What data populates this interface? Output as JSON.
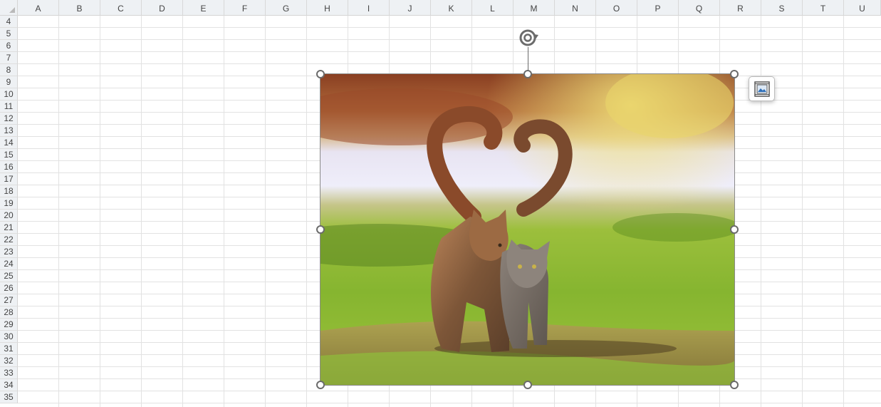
{
  "columns": [
    "A",
    "B",
    "C",
    "D",
    "E",
    "F",
    "G",
    "H",
    "I",
    "J",
    "K",
    "L",
    "M",
    "N",
    "O",
    "P",
    "Q",
    "R",
    "S",
    "T",
    "U"
  ],
  "rows": [
    "4",
    "5",
    "6",
    "7",
    "8",
    "9",
    "10",
    "11",
    "12",
    "13",
    "14",
    "15",
    "16",
    "17",
    "18",
    "19",
    "20",
    "21",
    "22",
    "23",
    "24",
    "25",
    "26",
    "27",
    "28",
    "29",
    "30",
    "31",
    "32",
    "33",
    "34",
    "35"
  ],
  "picture": {
    "subject": "two tabby cats walking on grass with tails forming a heart",
    "selected": true
  },
  "icons": {
    "rotate": "rotate-handle-icon",
    "layout_options": "layout-options-icon"
  },
  "colors": {
    "header_bg": "#eef1f4",
    "gridline": "#e2e2e2",
    "handle_border": "#6b6b6b"
  }
}
